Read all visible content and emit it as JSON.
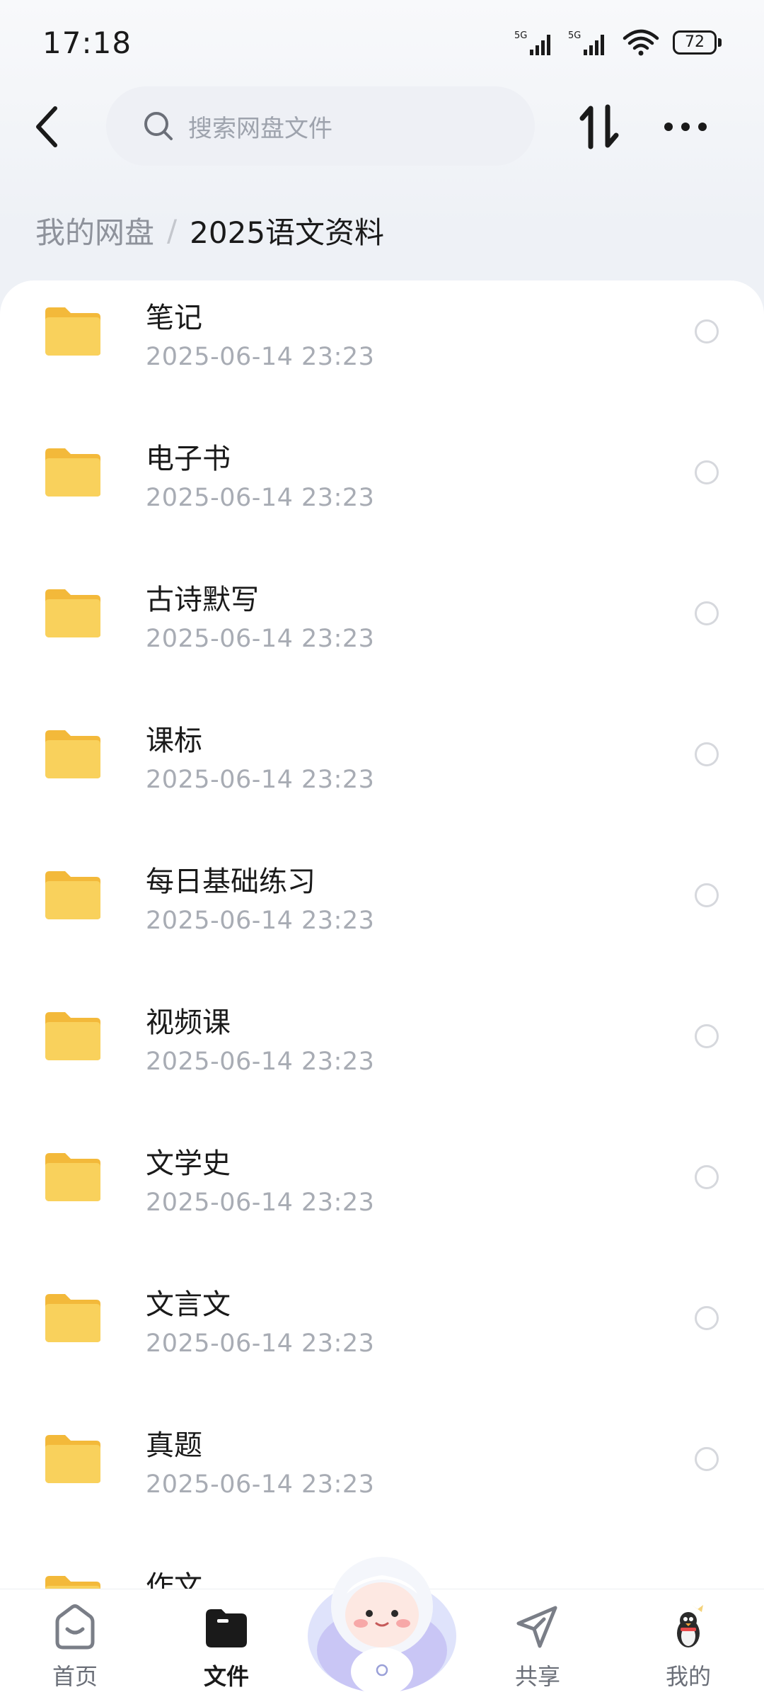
{
  "status_bar": {
    "time": "17:18",
    "signal_1": "5G",
    "signal_2": "5G",
    "battery": "72"
  },
  "top_nav": {
    "search_placeholder": "搜索网盘文件",
    "icons": [
      "back-icon",
      "search-icon",
      "sort-icon",
      "more-icon"
    ]
  },
  "breadcrumb": {
    "root": "我的网盘",
    "separator": "/",
    "current": "2025语文资料"
  },
  "files": [
    {
      "name": "笔记",
      "date": "2025-06-14  23:23"
    },
    {
      "name": "电子书",
      "date": "2025-06-14  23:23"
    },
    {
      "name": "古诗默写",
      "date": "2025-06-14  23:23"
    },
    {
      "name": "课标",
      "date": "2025-06-14  23:23"
    },
    {
      "name": "每日基础练习",
      "date": "2025-06-14  23:23"
    },
    {
      "name": "视频课",
      "date": "2025-06-14  23:23"
    },
    {
      "name": "文学史",
      "date": "2025-06-14  23:23"
    },
    {
      "name": "文言文",
      "date": "2025-06-14  23:23"
    },
    {
      "name": "真题",
      "date": "2025-06-14  23:23"
    },
    {
      "name": "作文",
      "date": ""
    }
  ],
  "tab_bar": {
    "tabs": [
      {
        "label": "首页",
        "icon": "home-icon"
      },
      {
        "label": "文件",
        "icon": "folder-icon",
        "active": true
      },
      {
        "label": "",
        "icon": "assistant-mascot-icon"
      },
      {
        "label": "共享",
        "icon": "share-icon"
      },
      {
        "label": "我的",
        "icon": "profile-icon"
      }
    ]
  },
  "colors": {
    "folder": "#f7c948",
    "accent": "#1a1a1a",
    "muted_text": "#a8acb4"
  }
}
